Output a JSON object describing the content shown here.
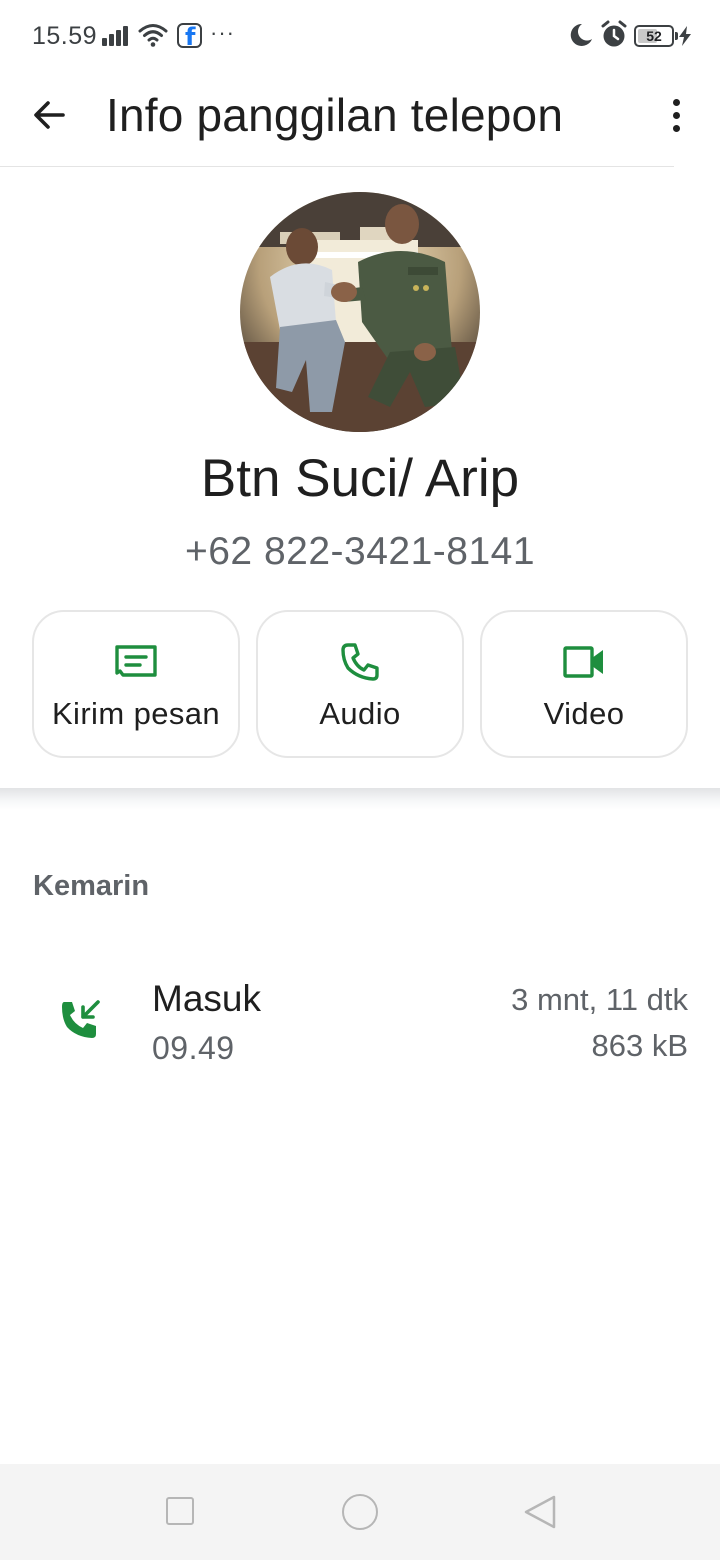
{
  "status_bar": {
    "time": "15.59",
    "dots": "···",
    "battery": "52",
    "icons": [
      "signal-icon",
      "wifi-icon",
      "facebook-icon",
      "moon-icon",
      "alarm-icon",
      "battery-icon",
      "charging-icon"
    ]
  },
  "app_bar": {
    "title": "Info panggilan telepon",
    "icons": [
      "arrow-back-icon",
      "more-vert-icon"
    ]
  },
  "contact": {
    "name": "Btn Suci/ Arip",
    "phone": "+62 822-3421-8141"
  },
  "actions": [
    {
      "label": "Kirim pesan",
      "icon": "message-icon"
    },
    {
      "label": "Audio",
      "icon": "phone-icon"
    },
    {
      "label": "Video",
      "icon": "videocam-icon"
    }
  ],
  "history": {
    "section_label": "Kemarin",
    "calls": [
      {
        "type": "Masuk",
        "time": "09.49",
        "duration": "3 mnt, 11 dtk",
        "size": "863 kB",
        "icon": "incoming-call-icon"
      }
    ]
  },
  "colors": {
    "accent": "#1e8e3e",
    "text_primary": "#1f1f1f",
    "text_secondary": "#5f6368",
    "button_border": "#e6e6e6",
    "nav_bar_bg": "#f4f4f4"
  },
  "nav_bar": {
    "icons": [
      "recents-square-icon",
      "home-circle-icon",
      "back-triangle-icon"
    ]
  }
}
